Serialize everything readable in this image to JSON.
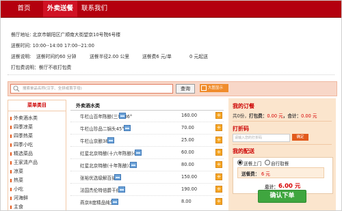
{
  "nav": {
    "items": [
      {
        "label": "首页",
        "active": false
      },
      {
        "label": "外卖送餐",
        "active": true
      },
      {
        "label": "联系我们",
        "active": false
      }
    ]
  },
  "info": {
    "address": "餐厅地址: 北京市朝阳区广顺南大街望京10号院6号楼",
    "delivery_time": "送餐时间:   10:00--14:00 17:00--21:00",
    "delivery_note_label": "送餐说明:",
    "delivery_duration": "送餐时间约60 分钟",
    "delivery_radius": "送餐半径2.00 公里",
    "delivery_fee": "送餐费6 元/单",
    "min_order": "0 元起送",
    "packing_note": "打包费说明：餐厅不收打包费"
  },
  "search": {
    "placeholder": "搜索单品名称(汉字、全拼或首字母)",
    "button_label": "查询",
    "bigpic_label": "大图显示"
  },
  "categories": {
    "header": "菜单类目",
    "items": [
      "外卖酒水类",
      "四季凉菜",
      "四季热菜",
      "四季小吃",
      "精选菜品",
      "王家清产品",
      "凉菜",
      "热菜",
      "小吃",
      "河海鲜",
      "主食"
    ]
  },
  "dishes": {
    "header": "外卖酒水类",
    "items": [
      {
        "name": "牛栏山百年陈酿(三年)36°",
        "price": "160.00"
      },
      {
        "name": "牛栏山珍品二锅头45°",
        "price": "70.00"
      },
      {
        "name": "牛栏山京酿38°",
        "price": "25.00"
      },
      {
        "name": "红星北京特酿(十六年陈酿)45°",
        "price": "60.00"
      },
      {
        "name": "红星北京特酿(十年陈酿)36°",
        "price": "80.00"
      },
      {
        "name": "张裕优选级解百纳",
        "price": "150.00"
      },
      {
        "name": "法国杰伦特倍爵干红",
        "price": "190.00"
      },
      {
        "name": "燕京8度精品纯生",
        "price": "8.00"
      }
    ]
  },
  "order": {
    "title": "我的订餐",
    "summary_prefix": "共0份，",
    "packing_label": "打包费：",
    "packing_value": "0.00 元",
    "total_label": "，合计：",
    "total_value": "0.00 元",
    "coupon_title": "打折码",
    "coupon_placeholder": "请输入您的打折码",
    "coupon_button": "确定",
    "delivery_title": "我的配送",
    "option_delivery": "送餐上门",
    "option_pickup": "自行取餐",
    "fee_label": "送餐费：",
    "fee_value": "6 元",
    "sum_label": "总计：",
    "sum_value": "6.00 元",
    "submit_label": "确认下单"
  },
  "colors": {
    "nav_bg": "#b4000e",
    "nav_active": "#d01224",
    "accent_red": "#d70000",
    "panel_bg": "#fbe5cd",
    "submit_green": "#3fa63f"
  }
}
